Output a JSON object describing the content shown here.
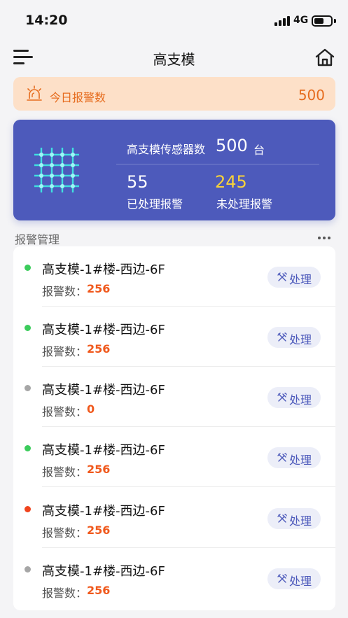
{
  "status_bar": {
    "time": "14:20",
    "network": "4G",
    "battery_level": 0.6
  },
  "nav": {
    "title": "高支模",
    "menu_icon": "menu-icon",
    "home_icon": "home-icon"
  },
  "alarm_today": {
    "label": "今日报警数",
    "value": "500",
    "icon": "alarm-bell-icon",
    "color": "#e66c1e",
    "background": "#fde0c8"
  },
  "sensor_card": {
    "icon": "sensor-grid-icon",
    "label": "高支模传感器数",
    "count": "500",
    "unit": "台",
    "handled_value": "55",
    "handled_label": "已处理报警",
    "unhandled_value": "245",
    "unhandled_label": "未处理报警",
    "background": "#4d5abb",
    "unhandled_color": "#f7d23a"
  },
  "section": {
    "title": "报警管理",
    "more_icon": "more-icon"
  },
  "alarm_items": [
    {
      "title": "高支模-1#楼-西边-6F",
      "count_label": "报警数：",
      "count": "256",
      "status_color": "#3ccc5c",
      "button_label": "处理"
    },
    {
      "title": "高支模-1#楼-西边-6F",
      "count_label": "报警数：",
      "count": "256",
      "status_color": "#3ccc5c",
      "button_label": "处理"
    },
    {
      "title": "高支模-1#楼-西边-6F",
      "count_label": "报警数：",
      "count": "0",
      "status_color": "#a6a6a6",
      "button_label": "处理"
    },
    {
      "title": "高支模-1#楼-西边-6F",
      "count_label": "报警数：",
      "count": "256",
      "status_color": "#3ccc5c",
      "button_label": "处理"
    },
    {
      "title": "高支模-1#楼-西边-6F",
      "count_label": "报警数：",
      "count": "256",
      "status_color": "#f0441d",
      "button_label": "处理"
    },
    {
      "title": "高支模-1#楼-西边-6F",
      "count_label": "报警数：",
      "count": "256",
      "status_color": "#a6a6a6",
      "button_label": "处理"
    }
  ]
}
